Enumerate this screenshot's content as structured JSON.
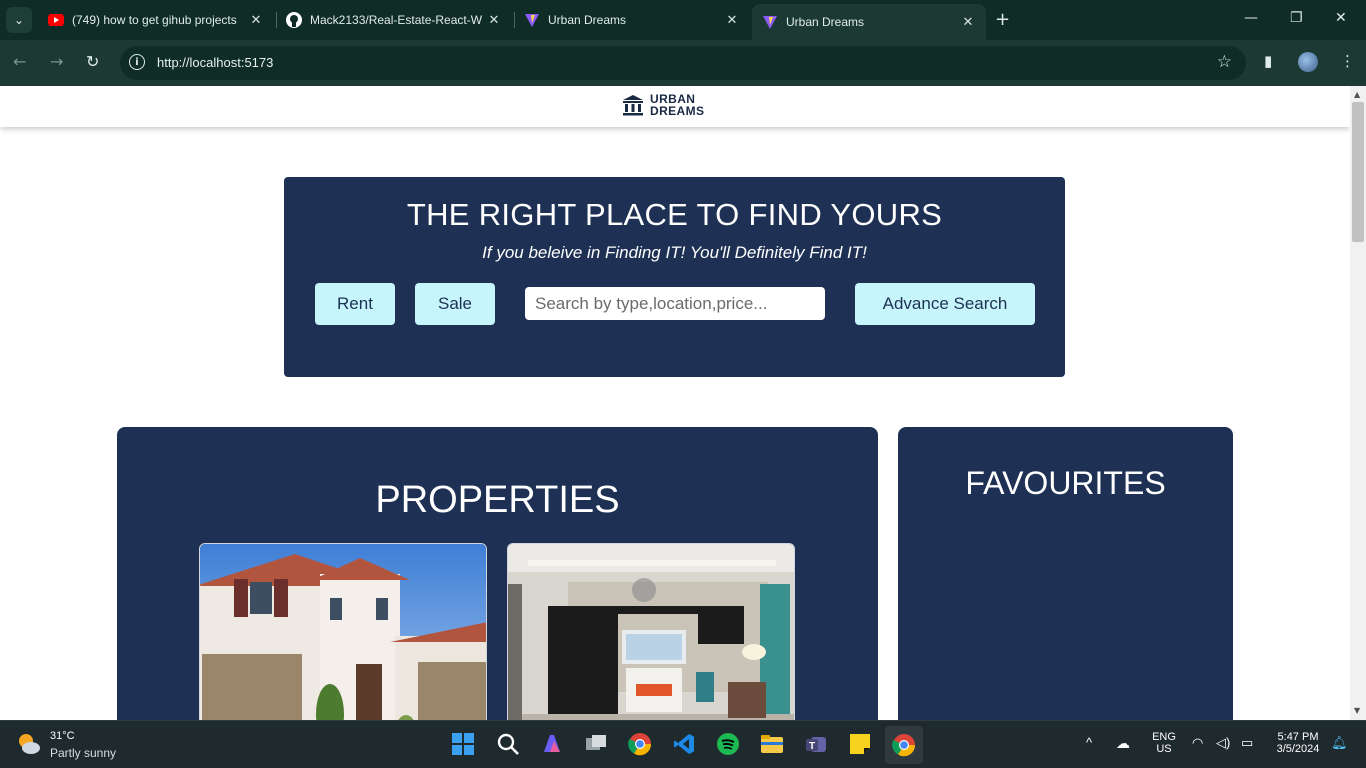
{
  "browser": {
    "tabs": [
      {
        "title": "(749) how to get gihub projects",
        "favicon": "youtube-icon",
        "active": false
      },
      {
        "title": "Mack2133/Real-Estate-React-W",
        "favicon": "github-icon",
        "active": false
      },
      {
        "title": "Urban Dreams",
        "favicon": "vite-icon",
        "active": false
      },
      {
        "title": "Urban Dreams",
        "favicon": "vite-icon",
        "active": true
      }
    ],
    "url": "http://localhost:5173"
  },
  "site": {
    "logo_line1": "URBAN",
    "logo_line2": "DREAMS",
    "hero": {
      "title": "THE RIGHT PLACE TO FIND YOURS",
      "subtitle": "If you beleive in Finding IT! You'll Definitely Find IT!",
      "rent_label": "Rent",
      "sale_label": "Sale",
      "search_placeholder": "Search by type,location,price...",
      "advance_label": "Advance Search"
    },
    "properties_title": "PROPERTIES",
    "favourites_title": "FAVOURITES",
    "colors": {
      "navy": "#1e3154",
      "cyan": "#c6f6fb"
    }
  },
  "taskbar": {
    "weather_temp": "31°C",
    "weather_desc": "Partly sunny",
    "lang_line1": "ENG",
    "lang_line2": "US",
    "time": "5:47 PM",
    "date": "3/5/2024"
  }
}
